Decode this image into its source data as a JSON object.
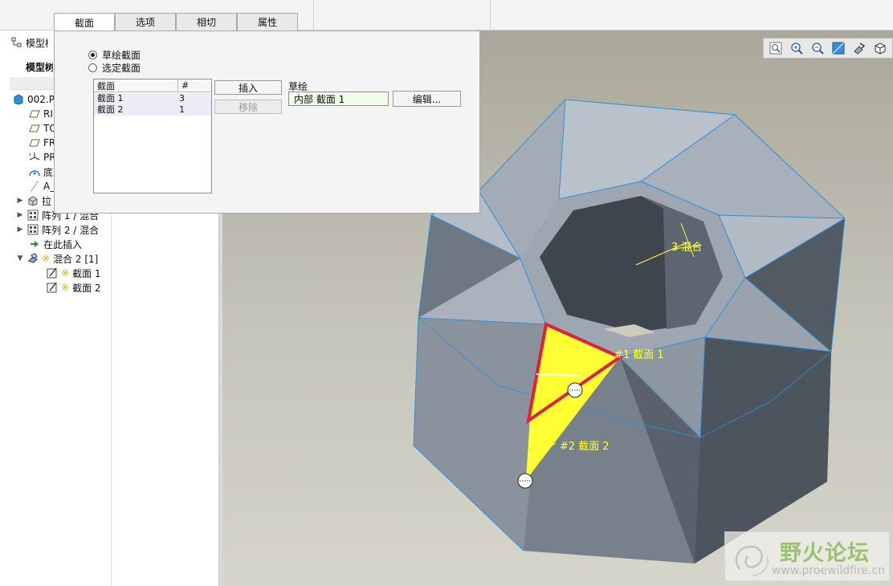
{
  "tabs": [
    {
      "label": "截面"
    },
    {
      "label": "选项"
    },
    {
      "label": "相切"
    },
    {
      "label": "属性"
    }
  ],
  "panel": {
    "radio_sketched": "草绘截面",
    "radio_selected": "选定截面",
    "table": {
      "headers": [
        "截面",
        "#"
      ],
      "rows": [
        {
          "name": "截面 1",
          "count": "3"
        },
        {
          "name": "截面 2",
          "count": "1"
        }
      ]
    },
    "insert_label": "插入",
    "remove_label": "移除",
    "sketch_label": "草绘",
    "sketch_value": "内部 截面 1",
    "edit_label": "编辑..."
  },
  "tree": {
    "header": "模型树",
    "header_visible": "模型树",
    "tab": "模型树",
    "items": [
      {
        "label": "002.P"
      },
      {
        "label": "RI"
      },
      {
        "label": "TO"
      },
      {
        "label": "FR"
      },
      {
        "label": "PR"
      },
      {
        "label": "底"
      },
      {
        "label": "A_"
      },
      {
        "label": "拉"
      },
      {
        "label": "阵列 1 / 混合"
      },
      {
        "label": "阵列 2 / 混合"
      },
      {
        "label": "在此插入"
      },
      {
        "label": "混合 2 [1]"
      },
      {
        "label": "截面 1"
      },
      {
        "label": "截面 2"
      }
    ]
  },
  "viewport": {
    "labels": {
      "section1": "#1 截面 1",
      "section2": "#2 截面 2",
      "blend": "3 混合"
    }
  },
  "view_toolbar": {
    "icons": [
      "refit-icon",
      "zoom-in-icon",
      "zoom-out-icon",
      "reorient-icon",
      "saved-views-icon",
      "display-style-icon"
    ]
  },
  "watermark": {
    "title": "野火论坛",
    "url": "www.proewildfire.cn"
  },
  "colors": {
    "highlight_red": "#e0203a",
    "section_yellow": "#ffff33",
    "edge_blue": "#2f8fd8",
    "part_face": "#7d8793"
  }
}
